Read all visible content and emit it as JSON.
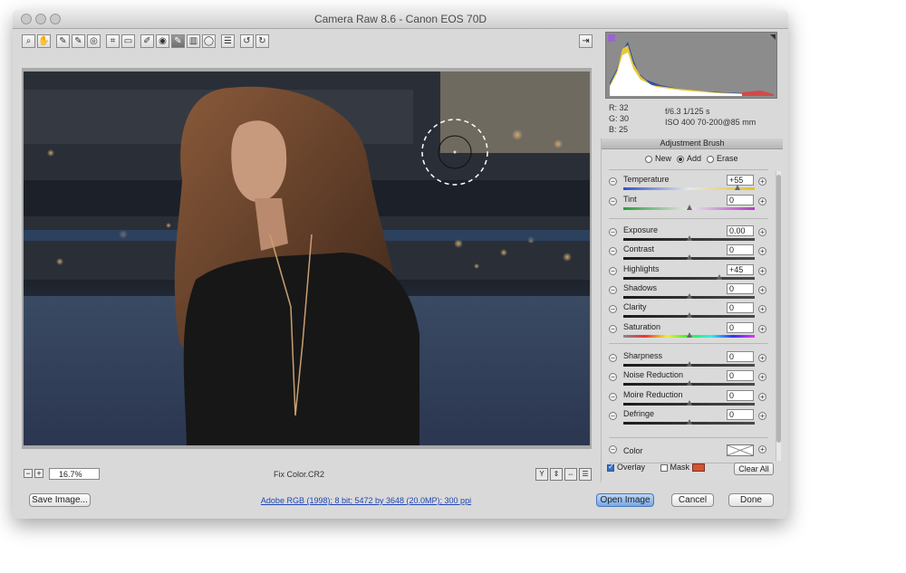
{
  "window": {
    "title": "Camera Raw 8.6  -  Canon EOS 70D"
  },
  "toolbar": {
    "tools": [
      {
        "name": "zoom-tool",
        "icon": "magnifier-icon",
        "glyph": "⌕"
      },
      {
        "name": "hand-tool",
        "icon": "hand-icon",
        "glyph": "✋"
      },
      {
        "name": "white-balance-tool",
        "icon": "eyedropper-icon",
        "glyph": "✎"
      },
      {
        "name": "color-sampler-tool",
        "icon": "sampler-icon",
        "glyph": "✎"
      },
      {
        "name": "targeted-adjustment-tool",
        "icon": "target-icon",
        "glyph": "◎"
      },
      {
        "name": "crop-tool",
        "icon": "crop-icon",
        "glyph": "⌗"
      },
      {
        "name": "straighten-tool",
        "icon": "straighten-icon",
        "glyph": "▭"
      },
      {
        "name": "spot-removal-tool",
        "icon": "brush-spot-icon",
        "glyph": "✐"
      },
      {
        "name": "red-eye-tool",
        "icon": "eye-icon",
        "glyph": "◉"
      },
      {
        "name": "adjustment-brush-tool",
        "icon": "brush-icon",
        "glyph": "✎",
        "active": true
      },
      {
        "name": "graduated-filter-tool",
        "icon": "gradient-icon",
        "glyph": "▥"
      },
      {
        "name": "radial-filter-tool",
        "icon": "radial-icon",
        "glyph": "◯"
      },
      {
        "name": "preferences-tool",
        "icon": "list-icon",
        "glyph": "☰"
      },
      {
        "name": "rotate-left-tool",
        "icon": "rotate-ccw-icon",
        "glyph": "↺"
      },
      {
        "name": "rotate-right-tool",
        "icon": "rotate-cw-icon",
        "glyph": "↻"
      }
    ],
    "export_icon": "⇥"
  },
  "status": {
    "zoom": "16.7%",
    "filename": "Fix Color.CR2",
    "view_icons": [
      "Y",
      "⇕",
      "⇔",
      "☰"
    ]
  },
  "readout": {
    "r": "R:  32",
    "g": "G:  30",
    "b": "B:  25",
    "aperture_shutter": "f/6.3    1/125 s",
    "iso_lens": "ISO 400    70-200@85 mm"
  },
  "panel": {
    "title": "Adjustment Brush",
    "modes": [
      "New",
      "Add",
      "Erase"
    ],
    "selected_mode": "Add",
    "sliders": [
      {
        "label": "Temperature",
        "value": "+55",
        "pos": 0.87,
        "track": "temperature"
      },
      {
        "label": "Tint",
        "value": "0",
        "pos": 0.5,
        "track": "tint"
      },
      {
        "label": "Exposure",
        "value": "0.00",
        "pos": 0.5,
        "track": "dark"
      },
      {
        "label": "Contrast",
        "value": "0",
        "pos": 0.5,
        "track": "dark"
      },
      {
        "label": "Highlights",
        "value": "+45",
        "pos": 0.73,
        "track": "dark"
      },
      {
        "label": "Shadows",
        "value": "0",
        "pos": 0.5,
        "track": "dark"
      },
      {
        "label": "Clarity",
        "value": "0",
        "pos": 0.5,
        "track": "dark"
      },
      {
        "label": "Saturation",
        "value": "0",
        "pos": 0.5,
        "track": "saturation"
      },
      {
        "label": "Sharpness",
        "value": "0",
        "pos": 0.5,
        "track": "dark"
      },
      {
        "label": "Noise Reduction",
        "value": "0",
        "pos": 0.5,
        "track": "dark"
      },
      {
        "label": "Moire Reduction",
        "value": "0",
        "pos": 0.5,
        "track": "dark"
      },
      {
        "label": "Defringe",
        "value": "0",
        "pos": 0.5,
        "track": "dark"
      }
    ],
    "color_label": "Color",
    "overlay_label": "Overlay",
    "mask_label": "Mask",
    "mask_color": "#d35434",
    "clear_all": "Clear All"
  },
  "footer": {
    "save": "Save Image...",
    "info": "Adobe RGB (1998); 8 bit; 5472 by 3648 (20.0MP); 300 ppi",
    "open": "Open Image",
    "cancel": "Cancel",
    "done": "Done"
  }
}
